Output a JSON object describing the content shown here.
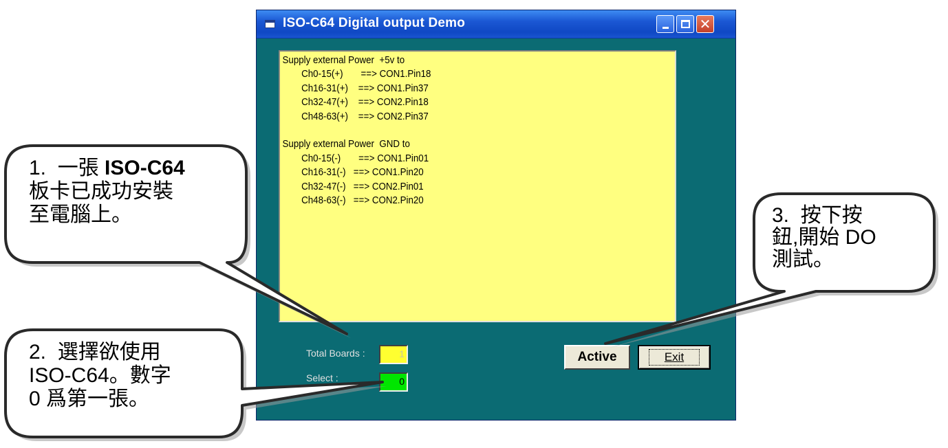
{
  "window": {
    "title": "ISO-C64 Digital output Demo",
    "info_lines": [
      "Supply external Power  +5v to",
      "Ch0-15(+)       ==> CON1.Pin18",
      "Ch16-31(+)    ==> CON1.Pin37",
      "Ch32-47(+)    ==> CON2.Pin18",
      "Ch48-63(+)    ==> CON2.Pin37",
      "",
      "Supply external Power  GND to",
      "Ch0-15(-)       ==> CON1.Pin01",
      "Ch16-31(-)   ==> CON1.Pin20",
      "Ch32-47(-)   ==> CON2.Pin01",
      "Ch48-63(-)   ==> CON2.Pin20"
    ],
    "total_boards_label": "Total Boards :",
    "total_boards_value": "1",
    "select_label": "Select :",
    "select_value": "0",
    "active_button": "Active",
    "exit_button": "Exit",
    "colors": {
      "window_bg": "#0b6b73",
      "textarea_bg": "#ffff80",
      "total_box_bg": "#ffff30",
      "select_box_bg": "#00e600"
    }
  },
  "callouts": {
    "c1": {
      "line1_prefix": "1.  一張 ",
      "line1_bold": "ISO-C64",
      "line2": "板卡已成功安裝",
      "line3": "至電腦上。"
    },
    "c2": {
      "line1": "2.  選擇欲使用",
      "line2": "ISO-C64。數字",
      "line3": "0 爲第一張。"
    },
    "c3": {
      "line1": "3.  按下按",
      "line2": "鈕,開始 DO",
      "line3": "測試。"
    }
  }
}
